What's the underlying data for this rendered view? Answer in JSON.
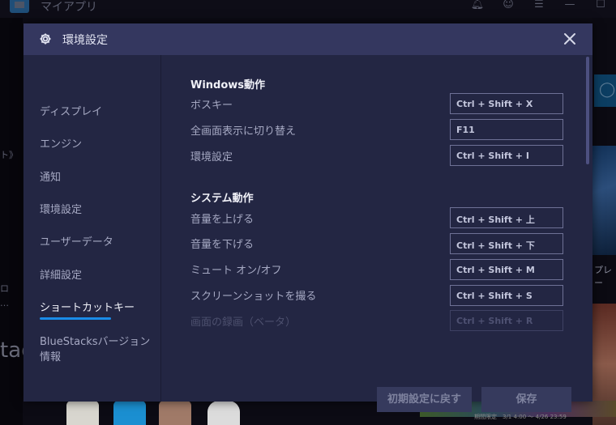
{
  "background_app": {
    "title": "マイアプリ",
    "top_icons": [
      "bell-icon",
      "account-icon",
      "menu-icon",
      "minimize-icon",
      "maximize-icon"
    ],
    "left_fragments": [
      "ト》",
      "ロ",
      "…",
      "tac"
    ],
    "right_fragment": "プレー",
    "banner_text": "期間限定　3/1 4:00 ～ 4/26 23:59"
  },
  "dialog": {
    "title": "環境設定",
    "icon": "gear-icon",
    "close_icon": "close-icon",
    "sidebar": {
      "items": [
        {
          "label": "ディスプレイ",
          "active": false
        },
        {
          "label": "エンジン",
          "active": false
        },
        {
          "label": "通知",
          "active": false
        },
        {
          "label": "環境設定",
          "active": false
        },
        {
          "label": "ユーザーデータ",
          "active": false
        },
        {
          "label": "詳細設定",
          "active": false
        },
        {
          "label": "ショートカットキー",
          "active": true
        },
        {
          "label": "BlueStacksバージョン情報",
          "active": false
        }
      ]
    },
    "sections": [
      {
        "title": "Windows動作",
        "rows": [
          {
            "label": "ボスキー",
            "shortcut": "Ctrl + Shift + X"
          },
          {
            "label": "全画面表示に切り替え",
            "shortcut": "F11"
          },
          {
            "label": "環境設定",
            "shortcut": "Ctrl + Shift + I"
          }
        ]
      },
      {
        "title": "システム動作",
        "rows": [
          {
            "label": "音量を上げる",
            "shortcut": "Ctrl + Shift + 上"
          },
          {
            "label": "音量を下げる",
            "shortcut": "Ctrl + Shift + 下"
          },
          {
            "label": "ミュート オン/オフ",
            "shortcut": "Ctrl + Shift + M"
          },
          {
            "label": "スクリーンショットを撮る",
            "shortcut": "Ctrl + Shift + S"
          },
          {
            "label": "画面の録画（ベータ）",
            "shortcut": "Ctrl + Shift + R",
            "disabled": true
          }
        ]
      }
    ],
    "buttons": {
      "reset": "初期設定に戻す",
      "save": "保存"
    },
    "colors": {
      "accent": "#1a8ce8",
      "header_bg": "#34375f",
      "body_bg": "#232643"
    }
  }
}
